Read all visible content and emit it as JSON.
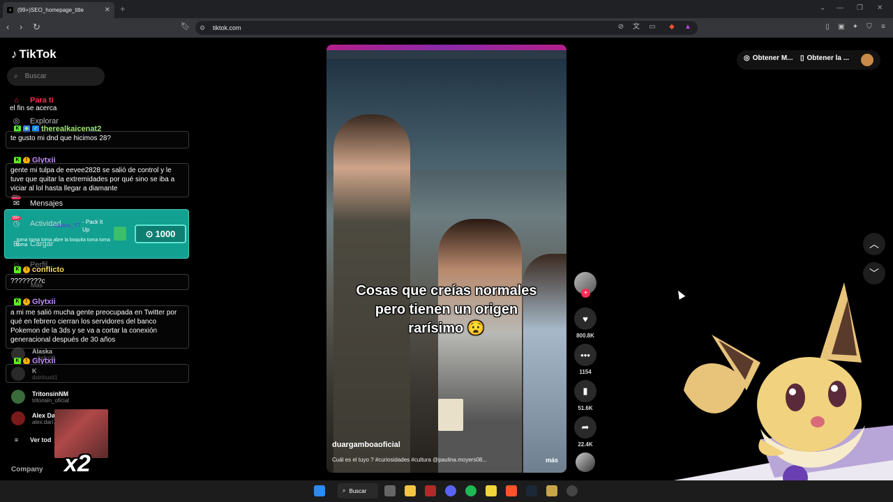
{
  "browser": {
    "tab_title": "(99+)SEO_homepage_title",
    "url": "tiktok.com"
  },
  "sidebar": {
    "logo": "TikTok",
    "search_placeholder": "Buscar",
    "nav": {
      "foryou": "Para ti",
      "explore": "Explorar",
      "messages": "Mensajes",
      "activity": "Actividad",
      "upload": "Cargar",
      "profile": "Perfil",
      "more": "Más",
      "messages_badge": "99+",
      "activity_badge": "99+"
    },
    "following": [
      {
        "name": "Alaska",
        "handle": "…ltello09"
      },
      {
        "name": "K",
        "handle": "doinhuxit1"
      },
      {
        "name": "TritonsinNM",
        "handle": "tritonsin_oficial"
      },
      {
        "name": "Alex Da…",
        "handle": "alex.dari…"
      }
    ],
    "see_all": "Ver tod",
    "company": "Company"
  },
  "chat": {
    "top_msg": "el fin se acerca",
    "messages": [
      {
        "user": "therealkaicenat2",
        "text": "te gusto mi dnd que hicimos 28?"
      },
      {
        "user": "Glytxii",
        "text": "gente mi tulpa de eevee2828 se salió de control y le tuve que quitar la extremidades por qué sino se iba a viciar al lol hasta llegar a diamante"
      },
      {
        "user": "conflicto",
        "text": "????????c"
      },
      {
        "user": "Glytxii",
        "text": "a mi me salió mucha gente preocupada en Twitter por qué en febrero cierran los servidores del banco Pokemon de la 3ds y se va a cortar la conexión generacional después de 30 años"
      },
      {
        "user": "Glytxii",
        "text": ""
      }
    ],
    "redeem": {
      "user": "…cavine_YT",
      "item": "- Pack It Up",
      "cost": "1000",
      "message": "toma toma toma abre la boquita toma toma toma"
    },
    "combo": "x2"
  },
  "video": {
    "caption": "Cosas que creías normales pero tienen un origen rarísimo 😧",
    "author": "duargamboaoficial",
    "description": "Cuál es el tuyo ? #curiosidades #cultura @paulina.moyers08...",
    "more": "más"
  },
  "actions": {
    "likes": "800.8K",
    "comments": "1154",
    "saves": "51.6K",
    "shares": "22.4K"
  },
  "topright": {
    "get_coins": "Obtener M...",
    "get_app": "Obtener la ..."
  },
  "taskbar": {
    "search": "Buscar"
  }
}
